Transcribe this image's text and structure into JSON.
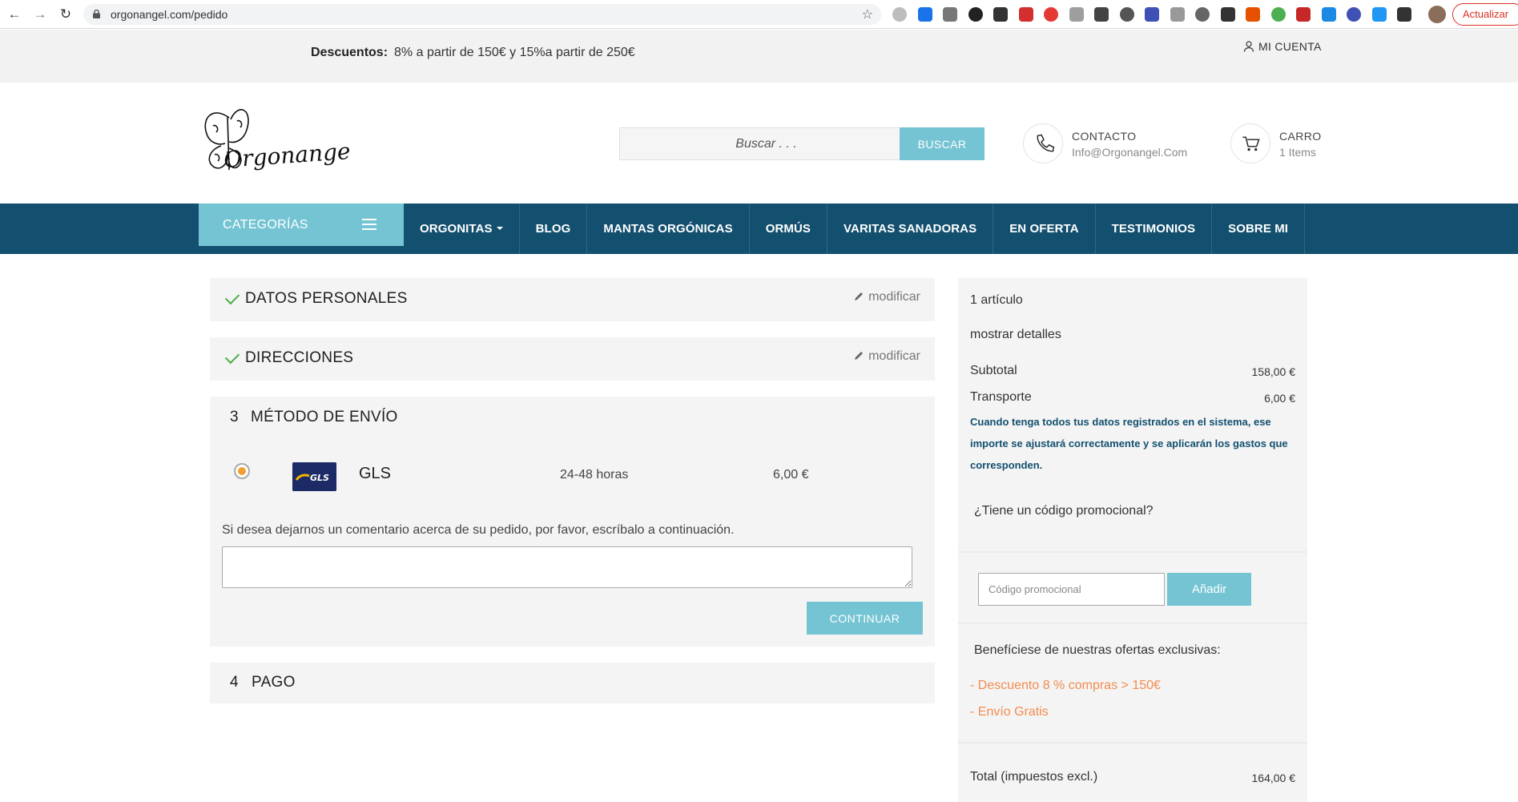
{
  "browser": {
    "url": "orgonangel.com/pedido",
    "update_label": "Actualizar",
    "extensions": [
      "#bdbdbd",
      "#1a73e8",
      "#777777",
      "#222222",
      "#333333",
      "#d32f2f",
      "#e53935",
      "#9e9e9e",
      "#444444",
      "#555555",
      "#3f51b5",
      "#999999",
      "#666666",
      "#333333",
      "#e65100",
      "#4caf50",
      "#c62828",
      "#1e88e5",
      "#3f51b5",
      "#2196f3",
      "#333333"
    ]
  },
  "topbar": {
    "discount_label": "Descuentos:",
    "discount_text": "8% a partir de 150€ y 15%a partir de 250€",
    "account": "MI CUENTA"
  },
  "header": {
    "search_placeholder": "Buscar . . .",
    "search_button": "BUSCAR",
    "contact_label": "CONTACTO",
    "contact_email": "Info@Orgonangel.Com",
    "cart_label": "CARRO",
    "cart_count": "1 Items"
  },
  "nav": {
    "categories": "CATEGORÍAS",
    "items": [
      "ORGONITAS",
      "BLOG",
      "MANTAS ORGÓNICAS",
      "ORMÚS",
      "VARITAS SANADORAS",
      "EN OFERTA",
      "TESTIMONIOS",
      "SOBRE MI"
    ]
  },
  "steps": {
    "personal": {
      "title": "DATOS PERSONALES",
      "modify": "modificar"
    },
    "address": {
      "title": "DIRECCIONES",
      "modify": "modificar"
    },
    "shipping": {
      "number": "3",
      "title": "MÉTODO DE ENVÍO",
      "carrier": "GLS",
      "carrier_logo_text": "GLS",
      "delay": "24-48 horas",
      "price": "6,00 €",
      "comment_label": "Si desea dejarnos un comentario acerca de su pedido, por favor, escríbalo a continuación.",
      "continue": "CONTINUAR"
    },
    "payment": {
      "number": "4",
      "title": "PAGO"
    }
  },
  "summary": {
    "items_count": "1 artículo",
    "show_details": "mostrar detalles",
    "subtotal_label": "Subtotal",
    "subtotal_value": "158,00 €",
    "shipping_label": "Transporte",
    "shipping_value": "6,00 €",
    "note": "Cuando tenga todos tus datos registrados en el sistema, ese importe se ajustará correctamente y se aplicarán los gastos que corresponden.",
    "promo_question": "¿Tiene un código promocional?",
    "promo_placeholder": "Código promocional",
    "promo_button": "Añadir",
    "offers_title": "Benefíciese de nuestras ofertas exclusivas:",
    "offer_1": "- Descuento 8 % compras > 150€",
    "offer_2": "- Envío Gratis",
    "total_label": "Total (impuestos excl.)",
    "total_value": "164,00 €"
  },
  "colors": {
    "accent": "#74c4d3",
    "navbar": "#13506f",
    "offer": "#f28c50",
    "check": "#4cae4c"
  }
}
